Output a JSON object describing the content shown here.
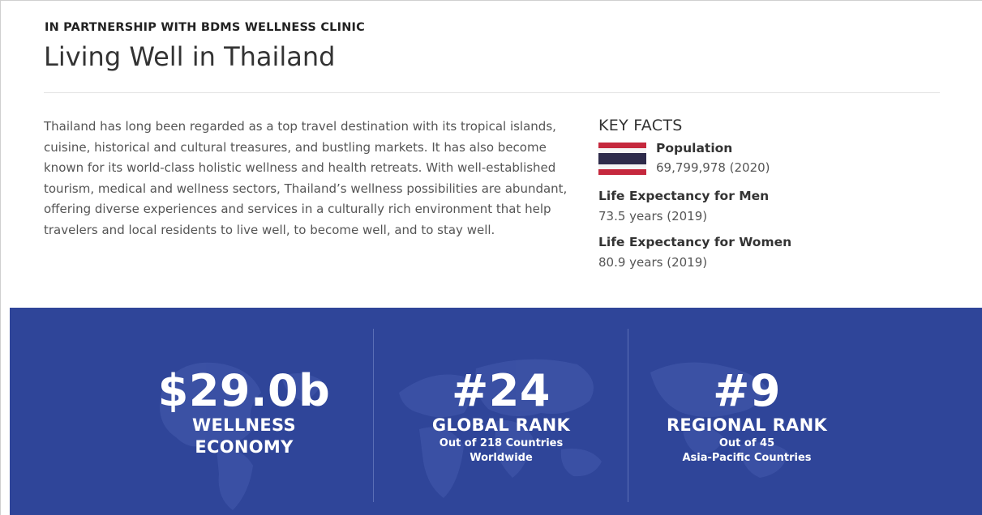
{
  "header": {
    "partner_line": "IN PARTNERSHIP WITH BDMS WELLNESS CLINIC",
    "title": "Living Well in Thailand"
  },
  "intro": {
    "text": "Thailand has long been regarded as a top travel destination with its tropical islands, cuisine, historical and cultural treasures, and bustling markets. It has also become known for its world-class holistic wellness and health retreats. With well-established tourism, medical and wellness sectors, Thailand’s wellness possibilities are abundant, offering diverse experiences and services in a culturally rich environment that help travelers and local residents to live well, to become well, and to stay well."
  },
  "key_facts": {
    "heading": "KEY FACTS",
    "flag_icon": "thailand-flag-icon",
    "flag_colors": [
      "#c5283d",
      "#f4f4f4",
      "#2d2a4a"
    ],
    "population": {
      "label": "Population",
      "value": "69,799,978 (2020)"
    },
    "items": [
      {
        "label": "Life Expectancy for Men",
        "value": "73.5 years (2019)"
      },
      {
        "label": "Life Expectancy for Women",
        "value": "80.9 years (2019)"
      }
    ]
  },
  "stats_band": {
    "background_color": "#2f4599",
    "background_icon": "world-map-icon",
    "stats": [
      {
        "value": "$29.0b",
        "label_lines": [
          "WELLNESS",
          "ECONOMY"
        ],
        "sub_lines": []
      },
      {
        "value": "#24",
        "label_lines": [
          "GLOBAL RANK"
        ],
        "sub_lines": [
          "Out of 218 Countries",
          "Worldwide"
        ]
      },
      {
        "value": "#9",
        "label_lines": [
          "REGIONAL RANK"
        ],
        "sub_lines": [
          "Out of 45",
          "Asia-Pacific Countries"
        ]
      }
    ]
  }
}
